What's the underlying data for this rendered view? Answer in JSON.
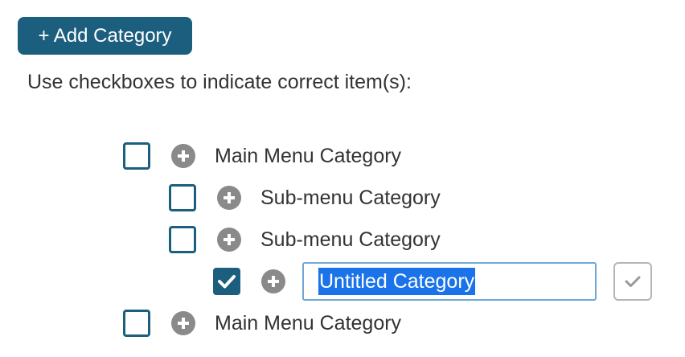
{
  "header": {
    "add_category_label": "+ Add Category"
  },
  "instruction": "Use checkboxes to indicate correct item(s):",
  "tree": [
    {
      "label": "Main Menu Category",
      "checked": false
    },
    {
      "label": "Sub-menu Category",
      "checked": false
    },
    {
      "label": "Sub-menu Category",
      "checked": false
    },
    {
      "input_value": "Untitled Category",
      "checked": true,
      "editing": true
    },
    {
      "label": "Main Menu Category",
      "checked": false
    }
  ],
  "icons": {
    "checkbox": "checkbox-icon",
    "expand": "plus-circle-icon",
    "confirm": "checkmark-icon"
  },
  "colors": {
    "accent": "#1b5e7e",
    "expand_icon": "#8a8a8a",
    "input_border": "#6fa8d8",
    "selection": "#1a73e8"
  }
}
